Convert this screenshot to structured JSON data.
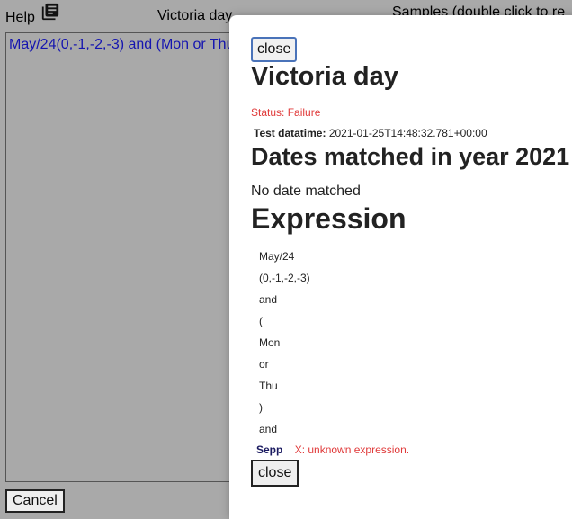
{
  "app": {
    "help_label": "Help",
    "title": "Victoria day",
    "samples_label": "Samples (double click to re",
    "expression_text": "May/24(0,-1,-2,-3) and (Mon or Thu",
    "cancel_label": "Cancel"
  },
  "modal": {
    "close_label": "close",
    "title": "Victoria day",
    "status": "Status: Failure",
    "test_datatime_label": "Test datatime:",
    "test_datatime_value": "2021-01-25T14:48:32.781+00:00",
    "dates_heading": "Dates matched in year 2021",
    "no_date_text": "No date matched",
    "expression_heading": "Expression",
    "tokens": [
      "May/24",
      "(0,-1,-2,-3)",
      "and",
      "(",
      "Mon",
      "or",
      "Thu",
      ")",
      "and"
    ],
    "error_token": "Sepp",
    "error_message": "X: unknown expression.",
    "close_bottom_label": "close"
  },
  "colors": {
    "overlay": "#a9a9a9",
    "expression_text": "#1515b0",
    "error": "#e03a3a"
  }
}
